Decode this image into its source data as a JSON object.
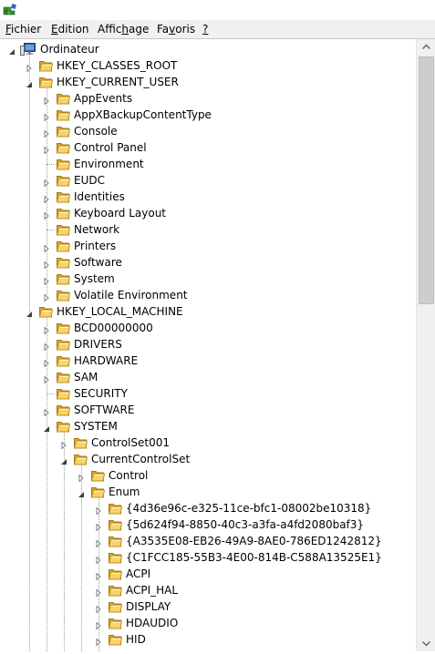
{
  "app": {
    "icon": "regedit-icon"
  },
  "menu": [
    {
      "label": "Fichier",
      "name": "menu-fichier"
    },
    {
      "label": "Edition",
      "name": "menu-edition"
    },
    {
      "label": "Affichage",
      "name": "menu-affichage"
    },
    {
      "label": "Favoris",
      "name": "menu-favoris"
    },
    {
      "label": "?",
      "name": "menu-help"
    }
  ],
  "tree": [
    {
      "label": "Ordinateur",
      "depth": 0,
      "state": "expanded",
      "icon": "computer-icon"
    },
    {
      "label": "HKEY_CLASSES_ROOT",
      "depth": 1,
      "state": "collapsed",
      "icon": "folder-icon"
    },
    {
      "label": "HKEY_CURRENT_USER",
      "depth": 1,
      "state": "expanded",
      "icon": "folder-icon"
    },
    {
      "label": "AppEvents",
      "depth": 2,
      "state": "collapsed",
      "icon": "folder-icon"
    },
    {
      "label": "AppXBackupContentType",
      "depth": 2,
      "state": "collapsed",
      "icon": "folder-icon"
    },
    {
      "label": "Console",
      "depth": 2,
      "state": "collapsed",
      "icon": "folder-icon"
    },
    {
      "label": "Control Panel",
      "depth": 2,
      "state": "collapsed",
      "icon": "folder-icon"
    },
    {
      "label": "Environment",
      "depth": 2,
      "state": "leaf",
      "icon": "folder-icon"
    },
    {
      "label": "EUDC",
      "depth": 2,
      "state": "collapsed",
      "icon": "folder-icon"
    },
    {
      "label": "Identities",
      "depth": 2,
      "state": "collapsed",
      "icon": "folder-icon"
    },
    {
      "label": "Keyboard Layout",
      "depth": 2,
      "state": "collapsed",
      "icon": "folder-icon"
    },
    {
      "label": "Network",
      "depth": 2,
      "state": "leaf",
      "icon": "folder-icon"
    },
    {
      "label": "Printers",
      "depth": 2,
      "state": "collapsed",
      "icon": "folder-icon"
    },
    {
      "label": "Software",
      "depth": 2,
      "state": "collapsed",
      "icon": "folder-icon"
    },
    {
      "label": "System",
      "depth": 2,
      "state": "collapsed",
      "icon": "folder-icon"
    },
    {
      "label": "Volatile Environment",
      "depth": 2,
      "state": "collapsed",
      "icon": "folder-icon"
    },
    {
      "label": "HKEY_LOCAL_MACHINE",
      "depth": 1,
      "state": "expanded",
      "icon": "folder-icon"
    },
    {
      "label": "BCD00000000",
      "depth": 2,
      "state": "collapsed",
      "icon": "folder-icon"
    },
    {
      "label": "DRIVERS",
      "depth": 2,
      "state": "collapsed",
      "icon": "folder-icon"
    },
    {
      "label": "HARDWARE",
      "depth": 2,
      "state": "collapsed",
      "icon": "folder-icon"
    },
    {
      "label": "SAM",
      "depth": 2,
      "state": "collapsed",
      "icon": "folder-icon"
    },
    {
      "label": "SECURITY",
      "depth": 2,
      "state": "leaf",
      "icon": "folder-icon"
    },
    {
      "label": "SOFTWARE",
      "depth": 2,
      "state": "collapsed",
      "icon": "folder-icon"
    },
    {
      "label": "SYSTEM",
      "depth": 2,
      "state": "expanded",
      "icon": "folder-icon"
    },
    {
      "label": "ControlSet001",
      "depth": 3,
      "state": "collapsed",
      "icon": "folder-icon"
    },
    {
      "label": "CurrentControlSet",
      "depth": 3,
      "state": "expanded",
      "icon": "folder-icon"
    },
    {
      "label": "Control",
      "depth": 4,
      "state": "collapsed",
      "icon": "folder-icon"
    },
    {
      "label": "Enum",
      "depth": 4,
      "state": "expanded",
      "icon": "folder-icon"
    },
    {
      "label": "{4d36e96c-e325-11ce-bfc1-08002be10318}",
      "depth": 5,
      "state": "collapsed",
      "icon": "folder-icon"
    },
    {
      "label": "{5d624f94-8850-40c3-a3fa-a4fd2080baf3}",
      "depth": 5,
      "state": "collapsed",
      "icon": "folder-icon"
    },
    {
      "label": "{A3535E08-EB26-49A9-8AE0-786ED1242812}",
      "depth": 5,
      "state": "collapsed",
      "icon": "folder-icon"
    },
    {
      "label": "{C1FCC185-55B3-4E00-814B-C588A13525E1}",
      "depth": 5,
      "state": "collapsed",
      "icon": "folder-icon"
    },
    {
      "label": "ACPI",
      "depth": 5,
      "state": "collapsed",
      "icon": "folder-icon"
    },
    {
      "label": "ACPI_HAL",
      "depth": 5,
      "state": "collapsed",
      "icon": "folder-icon"
    },
    {
      "label": "DISPLAY",
      "depth": 5,
      "state": "collapsed",
      "icon": "folder-icon"
    },
    {
      "label": "HDAUDIO",
      "depth": 5,
      "state": "collapsed",
      "icon": "folder-icon"
    },
    {
      "label": "HID",
      "depth": 5,
      "state": "collapsed",
      "icon": "folder-icon"
    }
  ],
  "scrollbar": {
    "position": 0,
    "visible_fraction": 0.4
  }
}
